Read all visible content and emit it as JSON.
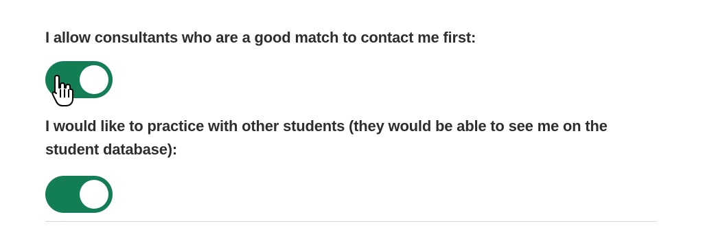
{
  "settings": [
    {
      "label": "I allow consultants who are a good match to contact me first:",
      "enabled": true
    },
    {
      "label": "I would like to practice with other students (they would be able to see me on the student database):",
      "enabled": true
    }
  ],
  "colors": {
    "toggle_on": "#137d55",
    "knob": "#ffffff",
    "text": "#2e2e2e",
    "divider": "#d9d9d9"
  },
  "cursor": {
    "icon": "hand-pointer-icon"
  }
}
